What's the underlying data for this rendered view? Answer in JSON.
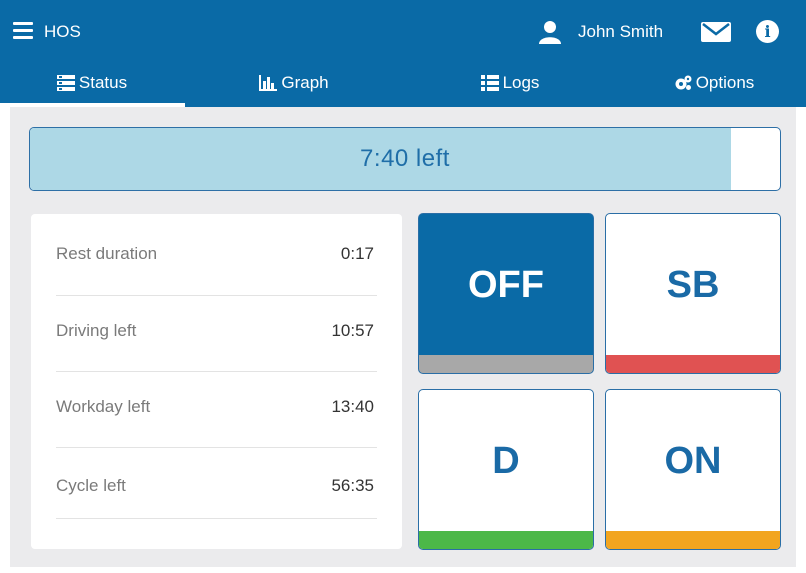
{
  "header": {
    "app_title": "HOS",
    "user_name": "John Smith",
    "icons": [
      "menu-icon",
      "user-icon",
      "mail-icon",
      "info-icon"
    ]
  },
  "tabs": [
    {
      "label": "Status",
      "icon": "status-icon",
      "active": true
    },
    {
      "label": "Graph",
      "icon": "graph-icon",
      "active": false
    },
    {
      "label": "Logs",
      "icon": "logs-icon",
      "active": false
    },
    {
      "label": "Options",
      "icon": "gears-icon",
      "active": false
    }
  ],
  "timer": {
    "text": "7:40 left",
    "fill_percent": 93.5
  },
  "info": [
    {
      "label": "Rest duration",
      "value": "0:17"
    },
    {
      "label": "Driving left",
      "value": "10:57"
    },
    {
      "label": "Workday left",
      "value": "13:40"
    },
    {
      "label": "Cycle left",
      "value": "56:35"
    }
  ],
  "duty_status": [
    {
      "code": "OFF",
      "color": "#a8a8a8",
      "active": true
    },
    {
      "code": "SB",
      "color": "#e05252",
      "active": false
    },
    {
      "code": "D",
      "color": "#4cb848",
      "active": false
    },
    {
      "code": "ON",
      "color": "#f2a51f",
      "active": false
    }
  ],
  "colors": {
    "primary": "#0a6aa6",
    "timer_fill": "#add8e6",
    "background": "#ebebed"
  }
}
